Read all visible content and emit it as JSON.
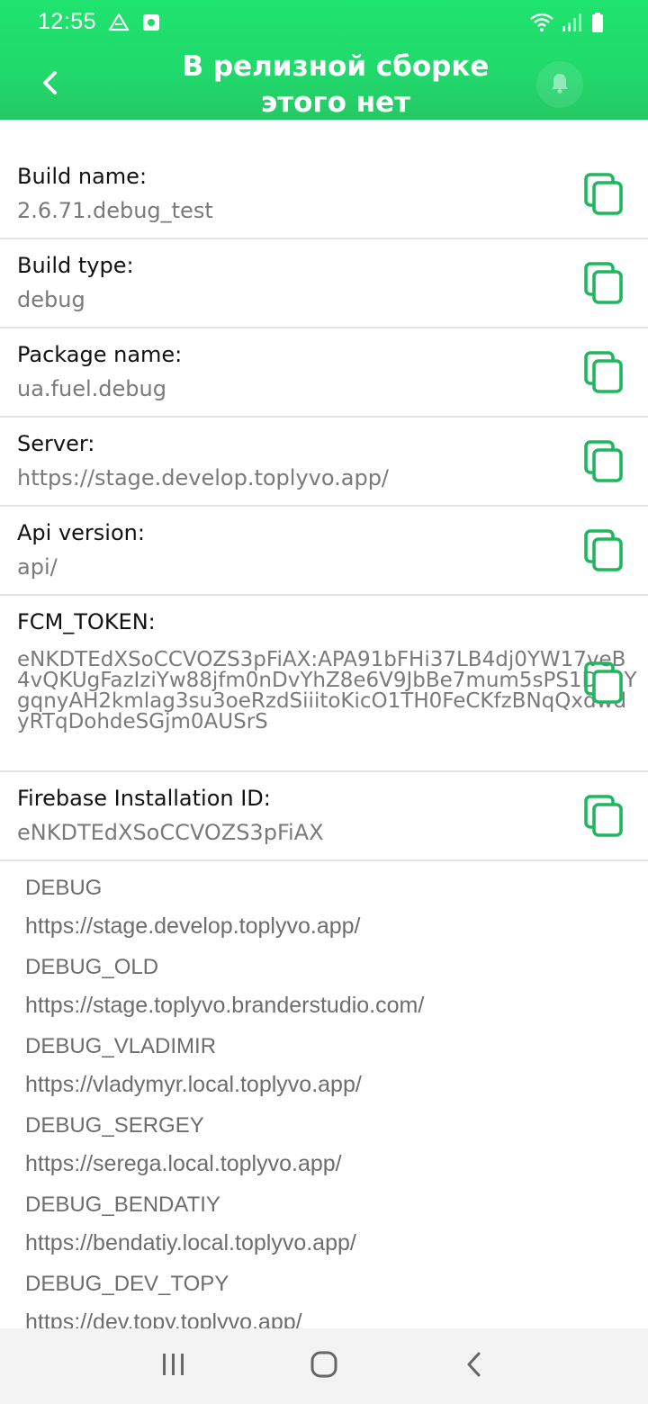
{
  "status_bar": {
    "time": "12:55",
    "left_icons": [
      "drive-icon",
      "screenshot-icon"
    ],
    "right_icons": [
      "wifi-icon",
      "signal-icon",
      "battery-icon"
    ]
  },
  "toolbar": {
    "title": "В релизной сборке этого нет",
    "back_icon": "chevron-left-icon",
    "bell_icon": "bell-icon"
  },
  "info_rows": [
    {
      "label": "Build name:",
      "value": "2.6.71.debug_test"
    },
    {
      "label": "Build type:",
      "value": "debug"
    },
    {
      "label": "Package name:",
      "value": "ua.fuel.debug"
    },
    {
      "label": "Server:",
      "value": "https://stage.develop.toplyvo.app/"
    },
    {
      "label": "Api version:",
      "value": "api/"
    },
    {
      "label": "FCM_TOKEN:",
      "value": "eNKDTEdXSoCCVOZS3pFiAX:APA91bFHi37LB4dj0YW17veB4vQKUgFazIziYw88jfm0nDvYhZ8e6V9JbBe7mum5sPS1D4hYgqnyAH2kmlag3su3oeRzdSiiitoKicO1TH0FeCKfzBNqQxdwdyRTqDohdeSGjm0AUSrS"
    },
    {
      "label": "Firebase Installation ID:",
      "value": "eNKDTEdXSoCCVOZS3pFiAX"
    }
  ],
  "servers": [
    {
      "name": "DEBUG",
      "url": "https://stage.develop.toplyvo.app/"
    },
    {
      "name": "DEBUG_OLD",
      "url": "https://stage.toplyvo.branderstudio.com/"
    },
    {
      "name": "DEBUG_VLADIMIR",
      "url": "https://vladymyr.local.toplyvo.app/"
    },
    {
      "name": "DEBUG_SERGEY",
      "url": "https://serega.local.toplyvo.app/"
    },
    {
      "name": "DEBUG_BENDATIY",
      "url": "https://bendatiy.local.toplyvo.app/"
    },
    {
      "name": "DEBUG_DEV_TOPY",
      "url": "https://dev.topy.toplyvo.app/"
    }
  ],
  "nav_bar": {
    "recents_icon": "recents-icon",
    "home_icon": "home-icon",
    "back_icon": "back-icon"
  },
  "colors": {
    "accent": "#21d96c",
    "copy_icon": "#1fb75e",
    "label": "#111111",
    "value": "#7a7a7a"
  }
}
